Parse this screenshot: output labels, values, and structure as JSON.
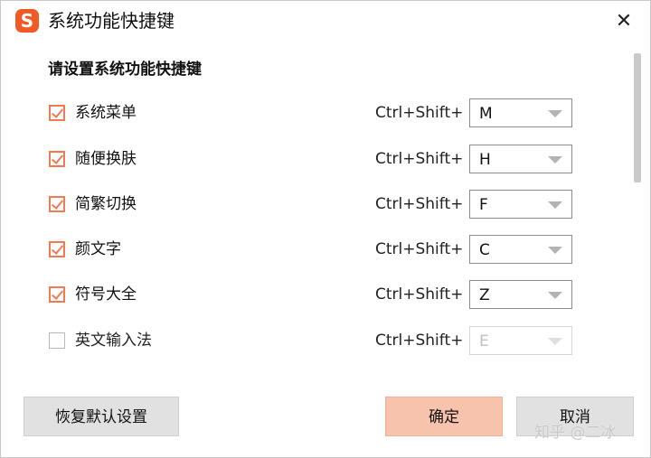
{
  "window": {
    "title": "系统功能快捷键",
    "logo_text": "S",
    "close_glyph": "✕"
  },
  "section_title": "请设置系统功能快捷键",
  "shortcuts": [
    {
      "label": "系统菜单",
      "checked": true,
      "prefix": "Ctrl+Shift+",
      "key": "M",
      "enabled": true
    },
    {
      "label": "随便换肤",
      "checked": true,
      "prefix": "Ctrl+Shift+",
      "key": "H",
      "enabled": true
    },
    {
      "label": "简繁切换",
      "checked": true,
      "prefix": "Ctrl+Shift+",
      "key": "F",
      "enabled": true
    },
    {
      "label": "颜文字",
      "checked": true,
      "prefix": "Ctrl+Shift+",
      "key": "C",
      "enabled": true
    },
    {
      "label": "符号大全",
      "checked": true,
      "prefix": "Ctrl+Shift+",
      "key": "Z",
      "enabled": true
    },
    {
      "label": "英文输入法",
      "checked": false,
      "prefix": "Ctrl+Shift+",
      "key": "E",
      "enabled": false
    }
  ],
  "buttons": {
    "reset": "恢复默认设置",
    "ok": "确定",
    "cancel": "取消"
  },
  "watermark": "知乎 @二冰",
  "colors": {
    "accent": "#f07a52",
    "ok_button": "#f8c3ac",
    "logo": "#f05a24"
  }
}
